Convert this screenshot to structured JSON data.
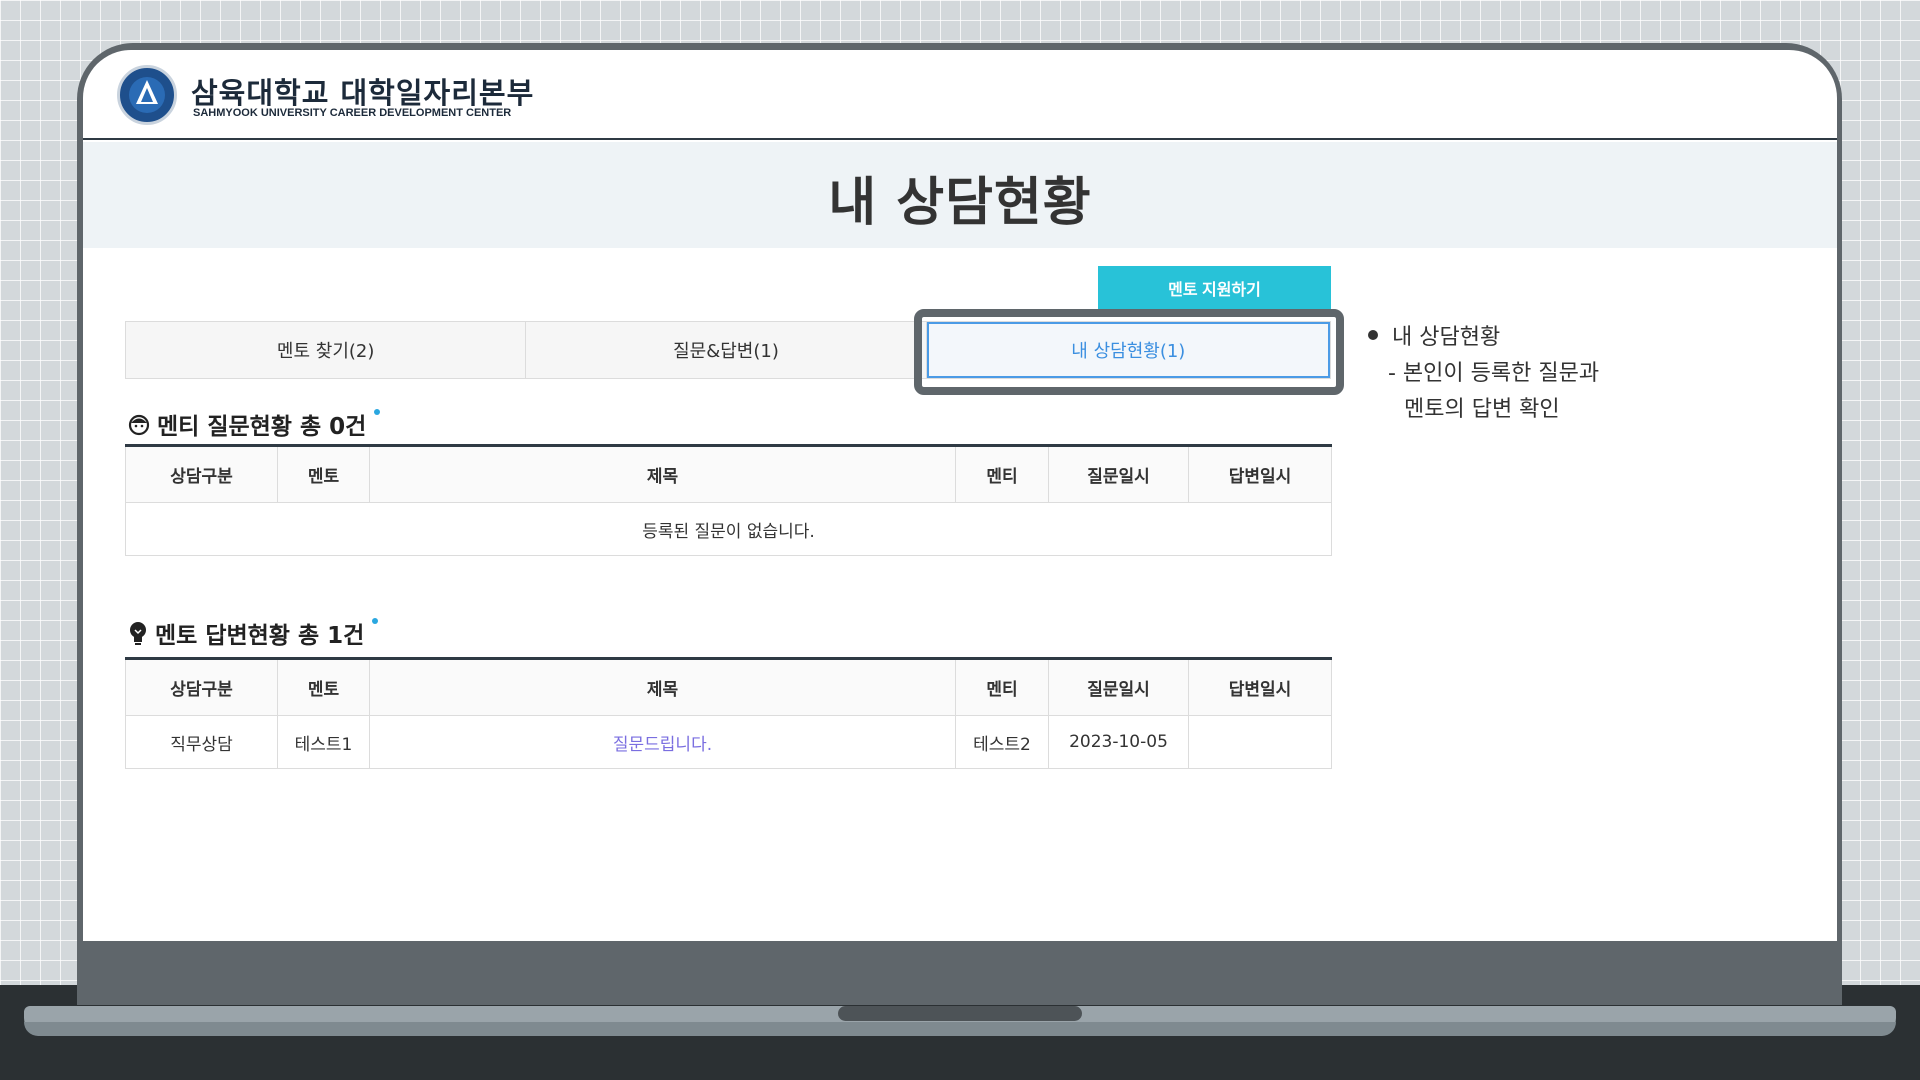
{
  "header": {
    "logo_title": "삼육대학교 대학일자리본부",
    "logo_subtitle": "SAHMYOOK UNIVERSITY CAREER DEVELOPMENT CENTER"
  },
  "page_title": "내 상담현황",
  "apply_button_label": "멘토 지원하기",
  "tabs": [
    {
      "label": "멘토 찾기(2)"
    },
    {
      "label": "질문&답변(1)"
    },
    {
      "label": "내 상담현황(1)"
    }
  ],
  "note": {
    "title": "내 상담현황",
    "line1": "- 본인이 등록한 질문과",
    "line2": "멘토의 답변 확인"
  },
  "mentee_section": {
    "title": "멘티 질문현황 총 0건",
    "columns": [
      "상담구분",
      "멘토",
      "제목",
      "멘티",
      "질문일시",
      "답변일시"
    ],
    "empty_message": "등록된 질문이 없습니다."
  },
  "mentor_section": {
    "title": "멘토 답변현황 총 1건",
    "columns": [
      "상담구분",
      "멘토",
      "제목",
      "멘티",
      "질문일시",
      "답변일시"
    ],
    "rows": [
      {
        "type": "직무상담",
        "mentor": "테스트1",
        "subject": "질문드립니다.",
        "mentee": "테스트2",
        "asked": "2023-10-05",
        "answered": ""
      }
    ]
  },
  "colors": {
    "accent_button": "#28c2d8",
    "active_tab": "#3b8fe0",
    "link": "#7a6ee0"
  }
}
